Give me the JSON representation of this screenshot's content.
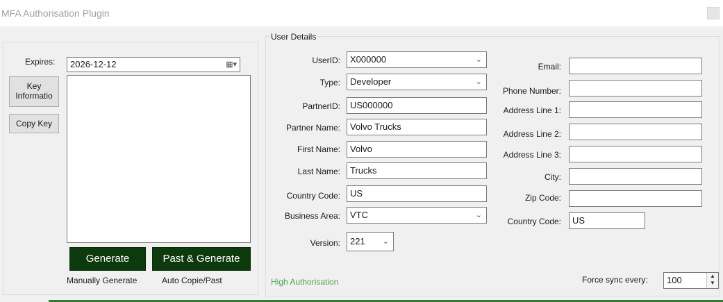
{
  "window": {
    "title": "MFA Authorisation Plugin"
  },
  "left": {
    "expires_label": "Expires:",
    "expires_value": "2026-12-12",
    "key_info_label": "Key\nInformatio",
    "copy_key_label": "Copy Key",
    "generate_label": "Generate",
    "past_generate_label": "Past & Generate",
    "manual_caption": "Manually Generate",
    "auto_caption": "Auto Copie/Past"
  },
  "user_details": {
    "group_title": "User Details",
    "userid": {
      "label": "UserID:",
      "value": "X000000"
    },
    "type": {
      "label": "Type:",
      "value": "Developer"
    },
    "partnerid": {
      "label": "PartnerID:",
      "value": "US000000"
    },
    "partner_name": {
      "label": "Partner Name:",
      "value": "Volvo Trucks"
    },
    "first_name": {
      "label": "First Name:",
      "value": "Volvo"
    },
    "last_name": {
      "label": "Last Name:",
      "value": "Trucks"
    },
    "country_code": {
      "label": "Country Code:",
      "value": "US"
    },
    "business_area": {
      "label": "Business Area:",
      "value": "VTC"
    },
    "version": {
      "label": "Version:",
      "value": "221"
    },
    "email": {
      "label": "Email:",
      "value": ""
    },
    "phone": {
      "label": "Phone Number:",
      "value": ""
    },
    "address1": {
      "label": "Address Line 1:",
      "value": ""
    },
    "address2": {
      "label": "Address Line 2:",
      "value": ""
    },
    "address3": {
      "label": "Address Line 3:",
      "value": ""
    },
    "city": {
      "label": "City:",
      "value": ""
    },
    "zip": {
      "label": "Zip Code:",
      "value": ""
    },
    "country_code2": {
      "label": "Country Code:",
      "value": "US"
    }
  },
  "status": {
    "auth_text": "High Authorisation"
  },
  "sync": {
    "label": "Force sync every:",
    "value": "100"
  },
  "colors": {
    "accent_green": "#0d3a0d",
    "status_green": "#4aa84a"
  }
}
